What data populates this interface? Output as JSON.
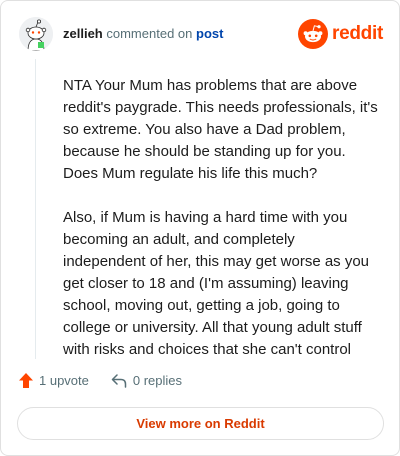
{
  "header": {
    "username": "zellieh",
    "action_text": "commented on",
    "post_link": "post",
    "brand_name": "reddit"
  },
  "comment": {
    "paragraphs": [
      "NTA Your Mum has problems that are above reddit's paygrade. This needs professionals, it's so extreme. You also have a Dad problem, because he should be standing up for you. Does Mum regulate his life this much?",
      "Also, if Mum is having a hard time with you becoming an adult, and completely independent of her, this may get worse as you get closer to 18 and (I'm assuming) leaving school, moving out, getting a job, going to college or university. All that young adult stuff with risks and choices that she can't control"
    ]
  },
  "actions": {
    "upvotes_label": "1 upvote",
    "replies_label": "0 replies"
  },
  "cta": {
    "label": "View more on Reddit"
  },
  "icons": {
    "avatar": "snoo-avatar-icon",
    "brand": "reddit-logo-icon",
    "upvote": "upvote-arrow-icon",
    "reply": "reply-arrow-icon"
  },
  "colors": {
    "brand": "#ff4500",
    "link": "#0045ac",
    "cta_text": "#d93a00",
    "muted": "#576f76"
  }
}
